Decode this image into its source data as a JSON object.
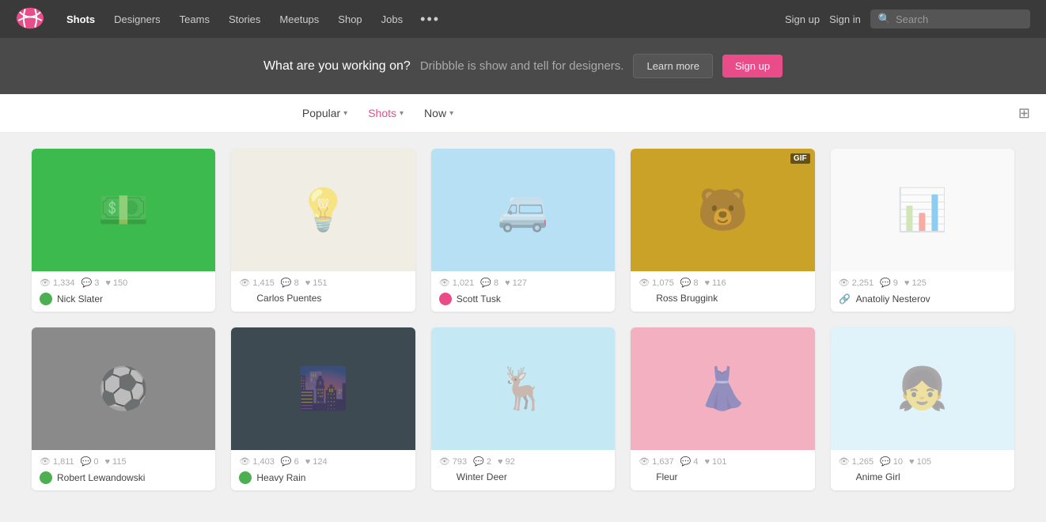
{
  "nav": {
    "logo_alt": "Dribbble",
    "links": [
      {
        "label": "Shots",
        "active": true,
        "id": "shots"
      },
      {
        "label": "Designers",
        "active": false,
        "id": "designers"
      },
      {
        "label": "Teams",
        "active": false,
        "id": "teams"
      },
      {
        "label": "Stories",
        "active": false,
        "id": "stories"
      },
      {
        "label": "Meetups",
        "active": false,
        "id": "meetups"
      },
      {
        "label": "Shop",
        "active": false,
        "id": "shop"
      },
      {
        "label": "Jobs",
        "active": false,
        "id": "jobs"
      }
    ],
    "more_label": "•••",
    "signup_label": "Sign up",
    "signin_label": "Sign in",
    "search_placeholder": "Search"
  },
  "banner": {
    "question": "What are you working on?",
    "description": "Dribbble is show and tell for designers.",
    "learn_more": "Learn more",
    "signup": "Sign up"
  },
  "filters": {
    "popular_label": "Popular",
    "shots_label": "Shots",
    "now_label": "Now"
  },
  "shots": [
    {
      "id": 1,
      "bg": "bg-green",
      "gif": false,
      "views": "1,334",
      "comments": "3",
      "likes": "150",
      "author_name": "Nick Slater",
      "badge_type": "green",
      "color": "#3dba4e",
      "icon": "💵"
    },
    {
      "id": 2,
      "bg": "bg-beige",
      "gif": false,
      "views": "1,415",
      "comments": "8",
      "likes": "151",
      "author_name": "Carlos Puentes",
      "badge_type": "none",
      "color": "#f0ede4",
      "icon": "💡"
    },
    {
      "id": 3,
      "bg": "bg-lightblue",
      "gif": false,
      "views": "1,021",
      "comments": "8",
      "likes": "127",
      "author_name": "Scott Tusk",
      "badge_type": "pink",
      "color": "#b8e0f5",
      "icon": "🚐"
    },
    {
      "id": 4,
      "bg": "bg-yellow",
      "gif": true,
      "views": "1,075",
      "comments": "8",
      "likes": "116",
      "author_name": "Ross Bruggink",
      "badge_type": "none",
      "color": "#c9a227",
      "icon": "🐻"
    },
    {
      "id": 5,
      "bg": "bg-white",
      "gif": false,
      "views": "2,251",
      "comments": "9",
      "likes": "125",
      "author_name": "Anatoliy Nesterov",
      "badge_type": "link",
      "color": "#f9f9f9",
      "icon": "📊"
    },
    {
      "id": 6,
      "bg": "bg-gray",
      "gif": false,
      "views": "1,811",
      "comments": "0",
      "likes": "115",
      "author_name": "Robert Lewandowski",
      "badge_type": "green",
      "color": "#7a7a7a",
      "icon": "⚽"
    },
    {
      "id": 7,
      "bg": "bg-darkslate",
      "gif": false,
      "views": "1,403",
      "comments": "6",
      "likes": "124",
      "author_name": "Heavy Rain",
      "badge_type": "green",
      "color": "#3d4a52",
      "icon": "🌧️"
    },
    {
      "id": 8,
      "bg": "bg-skyblue",
      "gif": false,
      "views": "793",
      "comments": "2",
      "likes": "92",
      "author_name": "Winter Deer",
      "badge_type": "none",
      "color": "#c5e8f5",
      "icon": "🦌"
    },
    {
      "id": 9,
      "bg": "bg-pink",
      "gif": false,
      "views": "1,637",
      "comments": "4",
      "likes": "101",
      "author_name": "Fleur",
      "badge_type": "none",
      "color": "#f2b0c0",
      "icon": "👗"
    },
    {
      "id": 10,
      "bg": "bg-lightcyan",
      "gif": false,
      "views": "1,265",
      "comments": "10",
      "likes": "105",
      "author_name": "Anime Girl",
      "badge_type": "none",
      "color": "#e0f2fa",
      "icon": "👧"
    }
  ]
}
